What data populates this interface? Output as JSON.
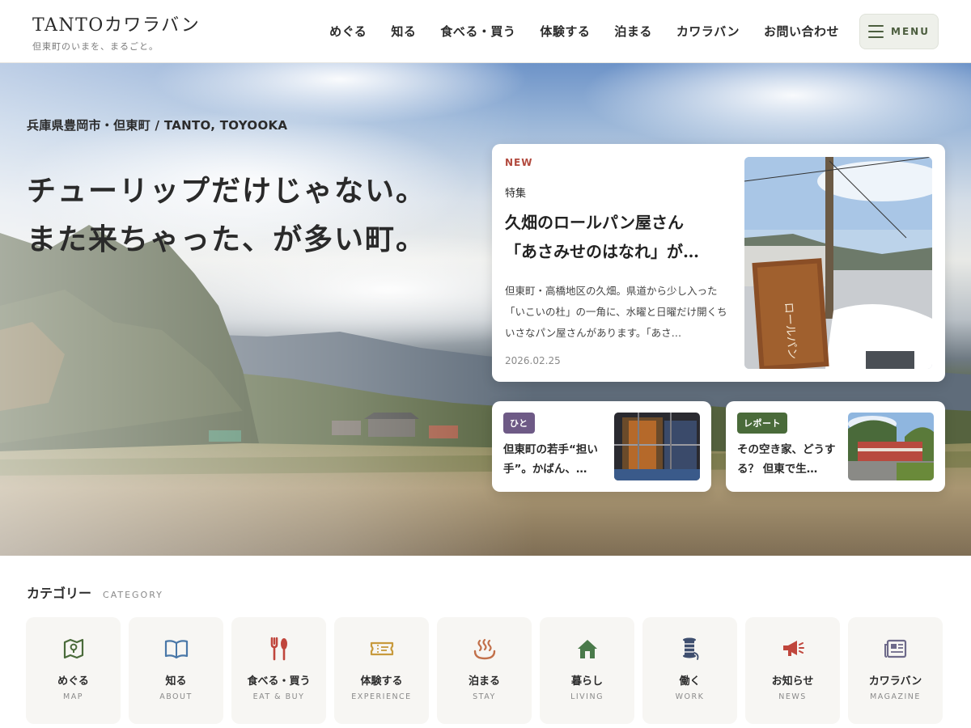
{
  "header": {
    "logo_title": "TANTOカワラバン",
    "logo_sub": "但東町のいまを、まるごと。",
    "nav": [
      "めぐる",
      "知る",
      "食べる・買う",
      "体験する",
      "泊まる",
      "カワラバン",
      "お問い合わせ"
    ],
    "menu_label": "MENU"
  },
  "hero": {
    "location": "兵庫県豊岡市・但東町 / TANTO, TOYOOKA",
    "catch_line1": "チューリップだけじゃない。",
    "catch_line2": "また来ちゃった、が多い町。"
  },
  "feature": {
    "badge": "NEW",
    "category": "特集",
    "title_line1": "久畑のロールパン屋さん",
    "title_line2": "「あさみせのはなれ」が…",
    "desc": "但東町・高橋地区の久畑。県道から少し入った「いこいの杜」の一角に、水曜と日曜だけ開くちいさなパン屋さんがあります。「あさ…",
    "date": "2026.02.25"
  },
  "cards": [
    {
      "tag": "ひと",
      "tag_color": "#6e5a86",
      "title": "但東町の若手“担い手”。かばん、…"
    },
    {
      "tag": "レポート",
      "tag_color": "#4a6b3a",
      "title": "その空き家、どうする？ 但東で生…"
    }
  ],
  "category": {
    "title": "カテゴリー",
    "title_en": "CATEGORY",
    "items": [
      {
        "ja": "めぐる",
        "en": "MAP",
        "icon": "map-icon",
        "color": "#4a6b3a"
      },
      {
        "ja": "知る",
        "en": "ABOUT",
        "icon": "book-icon",
        "color": "#4a78a8"
      },
      {
        "ja": "食べる・買う",
        "en": "EAT & BUY",
        "icon": "utensils-icon",
        "color": "#c0463c"
      },
      {
        "ja": "体験する",
        "en": "EXPERIENCE",
        "icon": "ticket-icon",
        "color": "#c79a3c"
      },
      {
        "ja": "泊まる",
        "en": "STAY",
        "icon": "hot-spring-icon",
        "color": "#c2704a"
      },
      {
        "ja": "暮らし",
        "en": "LIVING",
        "icon": "house-icon",
        "color": "#4a7a4a"
      },
      {
        "ja": "働く",
        "en": "WORK",
        "icon": "thread-spool-icon",
        "color": "#3e4e6e"
      },
      {
        "ja": "お知らせ",
        "en": "NEWS",
        "icon": "megaphone-icon",
        "color": "#c0463c"
      },
      {
        "ja": "カワラバン",
        "en": "MAGAZINE",
        "icon": "newspaper-icon",
        "color": "#6e6a8a"
      }
    ]
  }
}
